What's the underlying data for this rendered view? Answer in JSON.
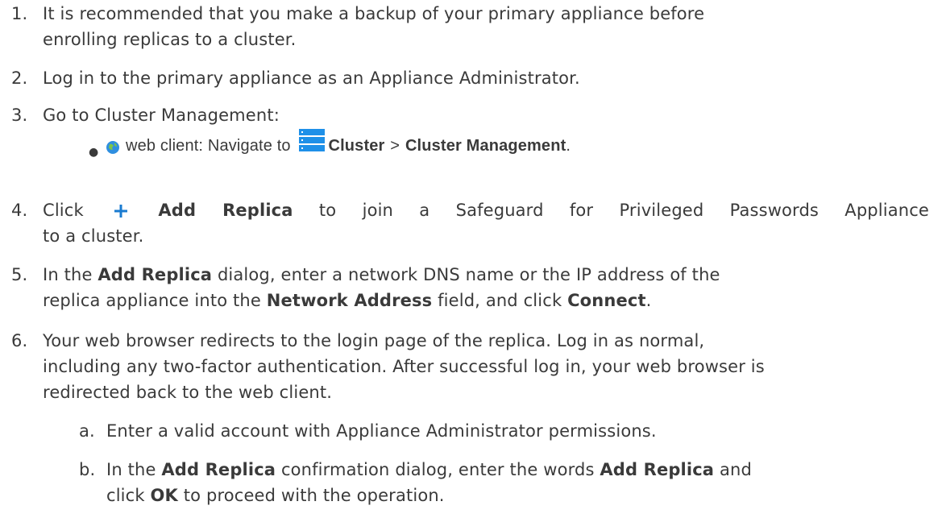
{
  "steps": [
    {
      "num": "1.",
      "lines": [
        "It is recommended that you make a backup of your primary appliance before",
        "enrolling replicas to a cluster."
      ]
    },
    {
      "num": "2.",
      "lines": [
        "Log in to the primary appliance as an Appliance Administrator."
      ]
    },
    {
      "num": "3.",
      "lines": [
        "Go to Cluster Management:"
      ]
    }
  ],
  "bullet": {
    "prefix": "web client: Navigate to",
    "cluster": "Cluster",
    "sep": ">",
    "cluster_mgmt": "Cluster Management",
    "end": ".",
    "icons": [
      "globe-icon",
      "server-stack-icon"
    ]
  },
  "step4": {
    "num": "4.",
    "click": "Click",
    "add_replica": "Add Replica",
    "rest": "to join a Safeguard for Privileged Passwords Appliance",
    "line2": "to a cluster.",
    "icon": "plus-icon",
    "icon_color": "#1a7bd0"
  },
  "step5": {
    "num": "5.",
    "a1": "In the",
    "b1": "Add Replica",
    "a2": "dialog, enter a network DNS name or the IP address of the",
    "a3": "replica appliance into the",
    "b2": "Network Address",
    "a4": "field, and click",
    "b3": "Connect",
    "a5": "."
  },
  "step6": {
    "num": "6.",
    "lines": [
      "Your web browser redirects to the login page of the replica. Log in as normal,",
      "including any two-factor authentication. After successful log in, your web browser is",
      "redirected back to the web client."
    ]
  },
  "substeps": {
    "a_num": "a.",
    "a_text": "Enter a valid account with Appliance Administrator permissions.",
    "b_num": "b.",
    "b1": "In the",
    "b2": "Add Replica",
    "b3": "confirmation dialog, enter the words",
    "b4": "Add Replica",
    "b5": "and",
    "b6": "click",
    "b7": "OK",
    "b8": "to proceed with the operation."
  }
}
